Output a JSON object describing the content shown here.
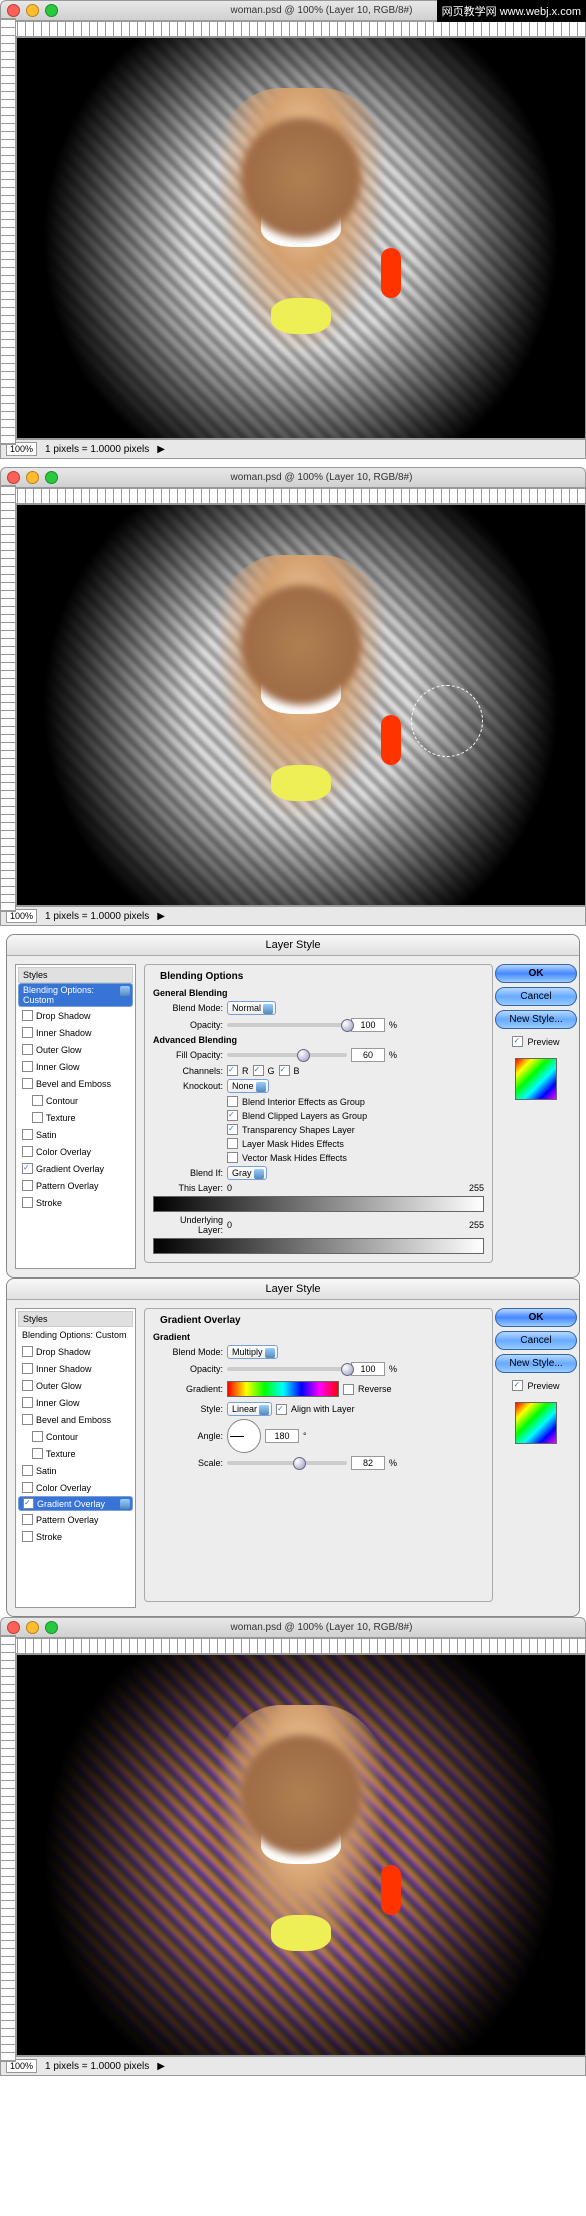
{
  "watermark": "网页教学网\nwww.webj.x.com",
  "window": {
    "title": "woman.psd @ 100% (Layer 10, RGB/8#)",
    "zoom": "100%",
    "pixel_info": "1 pixels = 1.0000 pixels"
  },
  "dialog1": {
    "title": "Layer Style",
    "styles_header": "Styles",
    "styles": [
      {
        "label": "Blending Options: Custom",
        "checked": null,
        "selected": true
      },
      {
        "label": "Drop Shadow",
        "checked": false
      },
      {
        "label": "Inner Shadow",
        "checked": false
      },
      {
        "label": "Outer Glow",
        "checked": false
      },
      {
        "label": "Inner Glow",
        "checked": false
      },
      {
        "label": "Bevel and Emboss",
        "checked": false
      },
      {
        "label": "Contour",
        "checked": false,
        "sub": true
      },
      {
        "label": "Texture",
        "checked": false,
        "sub": true
      },
      {
        "label": "Satin",
        "checked": false
      },
      {
        "label": "Color Overlay",
        "checked": false
      },
      {
        "label": "Gradient Overlay",
        "checked": true
      },
      {
        "label": "Pattern Overlay",
        "checked": false
      },
      {
        "label": "Stroke",
        "checked": false
      }
    ],
    "panel_title": "Blending Options",
    "general_title": "General Blending",
    "blend_mode_label": "Blend Mode:",
    "blend_mode": "Normal",
    "opacity_label": "Opacity:",
    "opacity": "100",
    "advanced_title": "Advanced Blending",
    "fill_opacity_label": "Fill Opacity:",
    "fill_opacity": "60",
    "channels_label": "Channels:",
    "ch_r": "R",
    "ch_g": "G",
    "ch_b": "B",
    "knockout_label": "Knockout:",
    "knockout": "None",
    "opts": [
      {
        "label": "Blend Interior Effects as Group",
        "on": false
      },
      {
        "label": "Blend Clipped Layers as Group",
        "on": true
      },
      {
        "label": "Transparency Shapes Layer",
        "on": true
      },
      {
        "label": "Layer Mask Hides Effects",
        "on": false
      },
      {
        "label": "Vector Mask Hides Effects",
        "on": false
      }
    ],
    "blendif_label": "Blend If:",
    "blendif": "Gray",
    "thislayer_label": "This Layer:",
    "thislayer_min": "0",
    "thislayer_max": "255",
    "underlayer_label": "Underlying Layer:",
    "underlayer_min": "0",
    "underlayer_max": "255",
    "ok": "OK",
    "cancel": "Cancel",
    "newstyle": "New Style...",
    "preview": "Preview"
  },
  "dialog2": {
    "title": "Layer Style",
    "styles_header": "Styles",
    "styles": [
      {
        "label": "Blending Options: Custom",
        "checked": null
      },
      {
        "label": "Drop Shadow",
        "checked": false
      },
      {
        "label": "Inner Shadow",
        "checked": false
      },
      {
        "label": "Outer Glow",
        "checked": false
      },
      {
        "label": "Inner Glow",
        "checked": false
      },
      {
        "label": "Bevel and Emboss",
        "checked": false
      },
      {
        "label": "Contour",
        "checked": false,
        "sub": true
      },
      {
        "label": "Texture",
        "checked": false,
        "sub": true
      },
      {
        "label": "Satin",
        "checked": false
      },
      {
        "label": "Color Overlay",
        "checked": false
      },
      {
        "label": "Gradient Overlay",
        "checked": true,
        "selected": true
      },
      {
        "label": "Pattern Overlay",
        "checked": false
      },
      {
        "label": "Stroke",
        "checked": false
      }
    ],
    "panel_title": "Gradient Overlay",
    "sub_title": "Gradient",
    "blend_mode_label": "Blend Mode:",
    "blend_mode": "Multiply",
    "opacity_label": "Opacity:",
    "opacity": "100",
    "gradient_label": "Gradient:",
    "reverse": "Reverse",
    "style_label": "Style:",
    "style": "Linear",
    "align": "Align with Layer",
    "angle_label": "Angle:",
    "angle": "180",
    "scale_label": "Scale:",
    "scale": "82",
    "pct": "%",
    "deg": "°",
    "ok": "OK",
    "cancel": "Cancel",
    "newstyle": "New Style...",
    "preview": "Preview"
  }
}
